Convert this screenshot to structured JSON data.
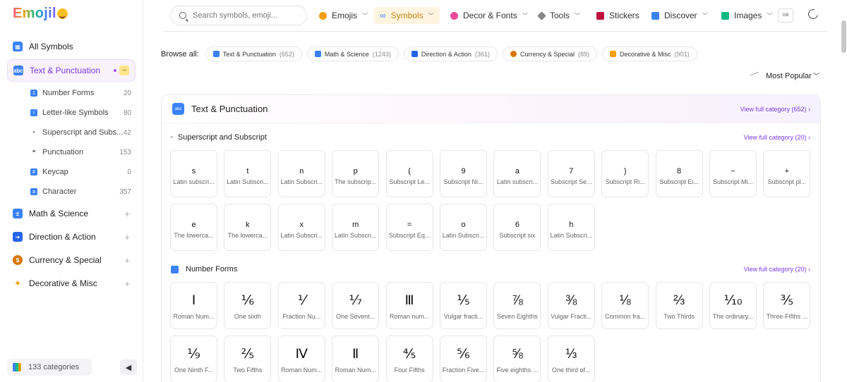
{
  "logo": {
    "text": "Emojil"
  },
  "sidebar": {
    "categories": [
      {
        "label": "All Symbols",
        "icon": "grid-icon",
        "color": "#3b82f6"
      },
      {
        "label": "Text & Punctuation",
        "icon": "abc-icon",
        "color": "#3b82f6"
      },
      {
        "label": "Math & Science",
        "icon": "math-icon",
        "color": "#3b82f6",
        "toggle": "+"
      },
      {
        "label": "Direction & Action",
        "icon": "arrow-icon",
        "color": "#2563eb",
        "toggle": "+"
      },
      {
        "label": "Currency & Special",
        "icon": "money-bag-icon",
        "color": "#d97706",
        "toggle": "+"
      },
      {
        "label": "Decorative & Misc",
        "icon": "sparkles-icon",
        "color": "#f59e0b",
        "toggle": "+"
      }
    ],
    "collapse_symbol": "–",
    "subcategories": [
      {
        "label": "Number Forms",
        "count": "20",
        "color": "#3b82f6"
      },
      {
        "label": "Letter-like Symbols",
        "count": "80",
        "color": "#3b82f6"
      },
      {
        "label": "Superscript and Subs...",
        "count": "42",
        "glyph": "ⁿ"
      },
      {
        "label": "Punctuation",
        "count": "153",
        "glyph": "❝"
      },
      {
        "label": "Keycap",
        "count": "0",
        "color": "#3b82f6"
      },
      {
        "label": "Character",
        "count": "357",
        "color": "#3b82f6"
      }
    ],
    "footer": {
      "label": "133 categories",
      "toggle": "◀"
    }
  },
  "topbar": {
    "search_placeholder": "Search symbols, emoji...",
    "nav": [
      {
        "label": "Emojis",
        "icon": "smile-icon",
        "color": "#f59e0b",
        "chevron": "﹀"
      },
      {
        "label": "Symbols",
        "icon": "infinity-icon",
        "color": "#3b82f6",
        "chevron": "﹀"
      },
      {
        "label": "Decor & Fonts",
        "icon": "palette-icon",
        "color": "#ec4899",
        "chevron": "﹀"
      },
      {
        "label": "Tools",
        "icon": "wrench-icon",
        "color": "#888888",
        "chevron": "﹀"
      },
      {
        "label": "Stickers",
        "icon": "ribbon-icon",
        "color": "#be123c"
      },
      {
        "label": "Discover",
        "icon": "book-icon",
        "color": "#3b82f6",
        "chevron": "﹀"
      },
      {
        "label": "Images",
        "icon": "picture-icon",
        "color": "#10b981",
        "chevron": "﹀"
      }
    ],
    "lang": "GB"
  },
  "browse": {
    "label": "Browse all:",
    "chips": [
      {
        "label": "Text & Punctuation",
        "count": "(652)",
        "color": "#3b82f6"
      },
      {
        "label": "Math & Science",
        "count": "(1243)",
        "color": "#3b82f6"
      },
      {
        "label": "Direction & Action",
        "count": "(361)",
        "color": "#2563eb"
      },
      {
        "label": "Currency & Special",
        "count": "(89)",
        "color": "#d97706"
      },
      {
        "label": "Decorative & Misc",
        "count": "(901)",
        "color": "#f59e0b"
      }
    ]
  },
  "sort": {
    "label": "Most Popular",
    "chevron": "﹀"
  },
  "panel": {
    "title": "Text & Punctuation",
    "icon_text": "abc",
    "view_all": "View full category (652)",
    "sections": [
      {
        "title": "Superscript and Subscript",
        "icon_glyph": "ⁿ",
        "view_all": "View full category (20)",
        "cards": [
          {
            "sym": "s",
            "name": "Latin subscri..."
          },
          {
            "sym": "t",
            "name": "Latin Subscri..."
          },
          {
            "sym": "n",
            "name": "Latin Subscri..."
          },
          {
            "sym": "p",
            "name": "The subscrip..."
          },
          {
            "sym": "(",
            "name": "Subscript Le..."
          },
          {
            "sym": "9",
            "name": "Subscript Ni..."
          },
          {
            "sym": "a",
            "name": "Latin subscri..."
          },
          {
            "sym": "7",
            "name": "Subscript Se..."
          },
          {
            "sym": ")",
            "name": "Subscript Ri..."
          },
          {
            "sym": "8",
            "name": "Subscript Ei..."
          },
          {
            "sym": "−",
            "name": "Subscript Mi..."
          },
          {
            "sym": "+",
            "name": "Subscript pl..."
          },
          {
            "sym": "e",
            "name": "The lowerca..."
          },
          {
            "sym": "k",
            "name": "The lowerca..."
          },
          {
            "sym": "x",
            "name": "Latin Subscri..."
          },
          {
            "sym": "m",
            "name": "Latin Subscri..."
          },
          {
            "sym": "=",
            "name": "Subscript Eq..."
          },
          {
            "sym": "o",
            "name": "Latin Subscri..."
          },
          {
            "sym": "6",
            "name": "Subscript six"
          },
          {
            "sym": "h",
            "name": "Latin Subscri..."
          }
        ]
      },
      {
        "title": "Number Forms",
        "view_all": "View full category (20)",
        "cards": [
          {
            "sym": "Ⅰ",
            "name": "Roman Num..."
          },
          {
            "sym": "⅙",
            "name": "One sixth"
          },
          {
            "sym": "⅟",
            "name": "Fraction Nu..."
          },
          {
            "sym": "⅐",
            "name": "One Sevent..."
          },
          {
            "sym": "Ⅲ",
            "name": "Roman num..."
          },
          {
            "sym": "⅕",
            "name": "Vulgar fracti..."
          },
          {
            "sym": "⅞",
            "name": "Seven Eighths"
          },
          {
            "sym": "⅜",
            "name": "Vulgar Fracti..."
          },
          {
            "sym": "⅛",
            "name": "Common fra..."
          },
          {
            "sym": "⅔",
            "name": "Two Thirds"
          },
          {
            "sym": "⅒",
            "name": "The ordinary..."
          },
          {
            "sym": "⅗",
            "name": "Three-Fifths ..."
          },
          {
            "sym": "⅑",
            "name": "One Ninth F..."
          },
          {
            "sym": "⅖",
            "name": "Two Fifths"
          },
          {
            "sym": "Ⅳ",
            "name": "Roman Num..."
          },
          {
            "sym": "Ⅱ",
            "name": "Roman Num..."
          },
          {
            "sym": "⅘",
            "name": "Four Fifths"
          },
          {
            "sym": "⅚",
            "name": "Fraction Five..."
          },
          {
            "sym": "⅝",
            "name": "Five eighths ..."
          },
          {
            "sym": "⅓",
            "name": "One third of..."
          }
        ]
      }
    ]
  }
}
